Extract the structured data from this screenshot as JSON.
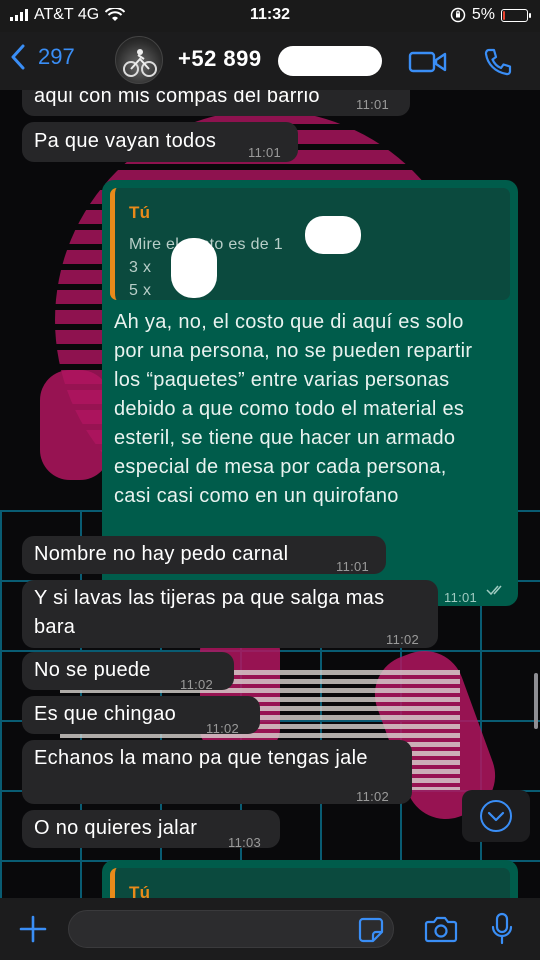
{
  "status_bar": {
    "carrier": "AT&T 4G",
    "time": "11:32",
    "battery": "5%",
    "battery_level": 0.05
  },
  "header": {
    "back_count": "297",
    "contact_name": "+52 899"
  },
  "messages": [
    {
      "side": "in",
      "text": "aqui con mis compas del barrio",
      "time": "11:01"
    },
    {
      "side": "in",
      "text": "Pa que vayan todos",
      "time": "11:01"
    },
    {
      "side": "out",
      "quote_author": "Tú",
      "quote_lines": [
        "Mire el costo es de 1",
        "3 x",
        "5 x"
      ],
      "text": "Ah ya, no, el costo que di aquí es solo\npor una persona, no se pueden repartir\nlos “paquetes” entre varias personas\ndebido a que como todo el material es\nesteril, se tiene que hacer un armado\nespecial de mesa por cada persona,\ncasi casi como en un quirofano",
      "time": "11:01"
    },
    {
      "side": "in",
      "text": "Nombre no hay pedo carnal",
      "time": "11:01"
    },
    {
      "side": "in",
      "text": "Y si lavas las tijeras pa que salga mas\nbara",
      "time": "11:02"
    },
    {
      "side": "in",
      "text": "No se puede",
      "time": "11:02"
    },
    {
      "side": "in",
      "text": "Es que chingao",
      "time": "11:02"
    },
    {
      "side": "in",
      "text": "Echanos la mano pa que tengas jale",
      "time": "11:02"
    },
    {
      "side": "in",
      "text": "O no quieres jalar",
      "time": "11:03"
    },
    {
      "side": "out",
      "quote_author": "Tú"
    }
  ],
  "input": {
    "placeholder": "",
    "value": ""
  },
  "icons": {
    "back": "chevron-left-icon",
    "video": "video-camera-icon",
    "call": "phone-icon",
    "add": "plus-icon",
    "sticker": "sticker-icon",
    "camera": "camera-icon",
    "mic": "microphone-icon",
    "scroll": "chevron-down-icon"
  },
  "colors": {
    "accent": "#3a8ef6",
    "outgoing": "#005c4b",
    "incoming": "#262628",
    "quote_author": "#e88a1a"
  }
}
